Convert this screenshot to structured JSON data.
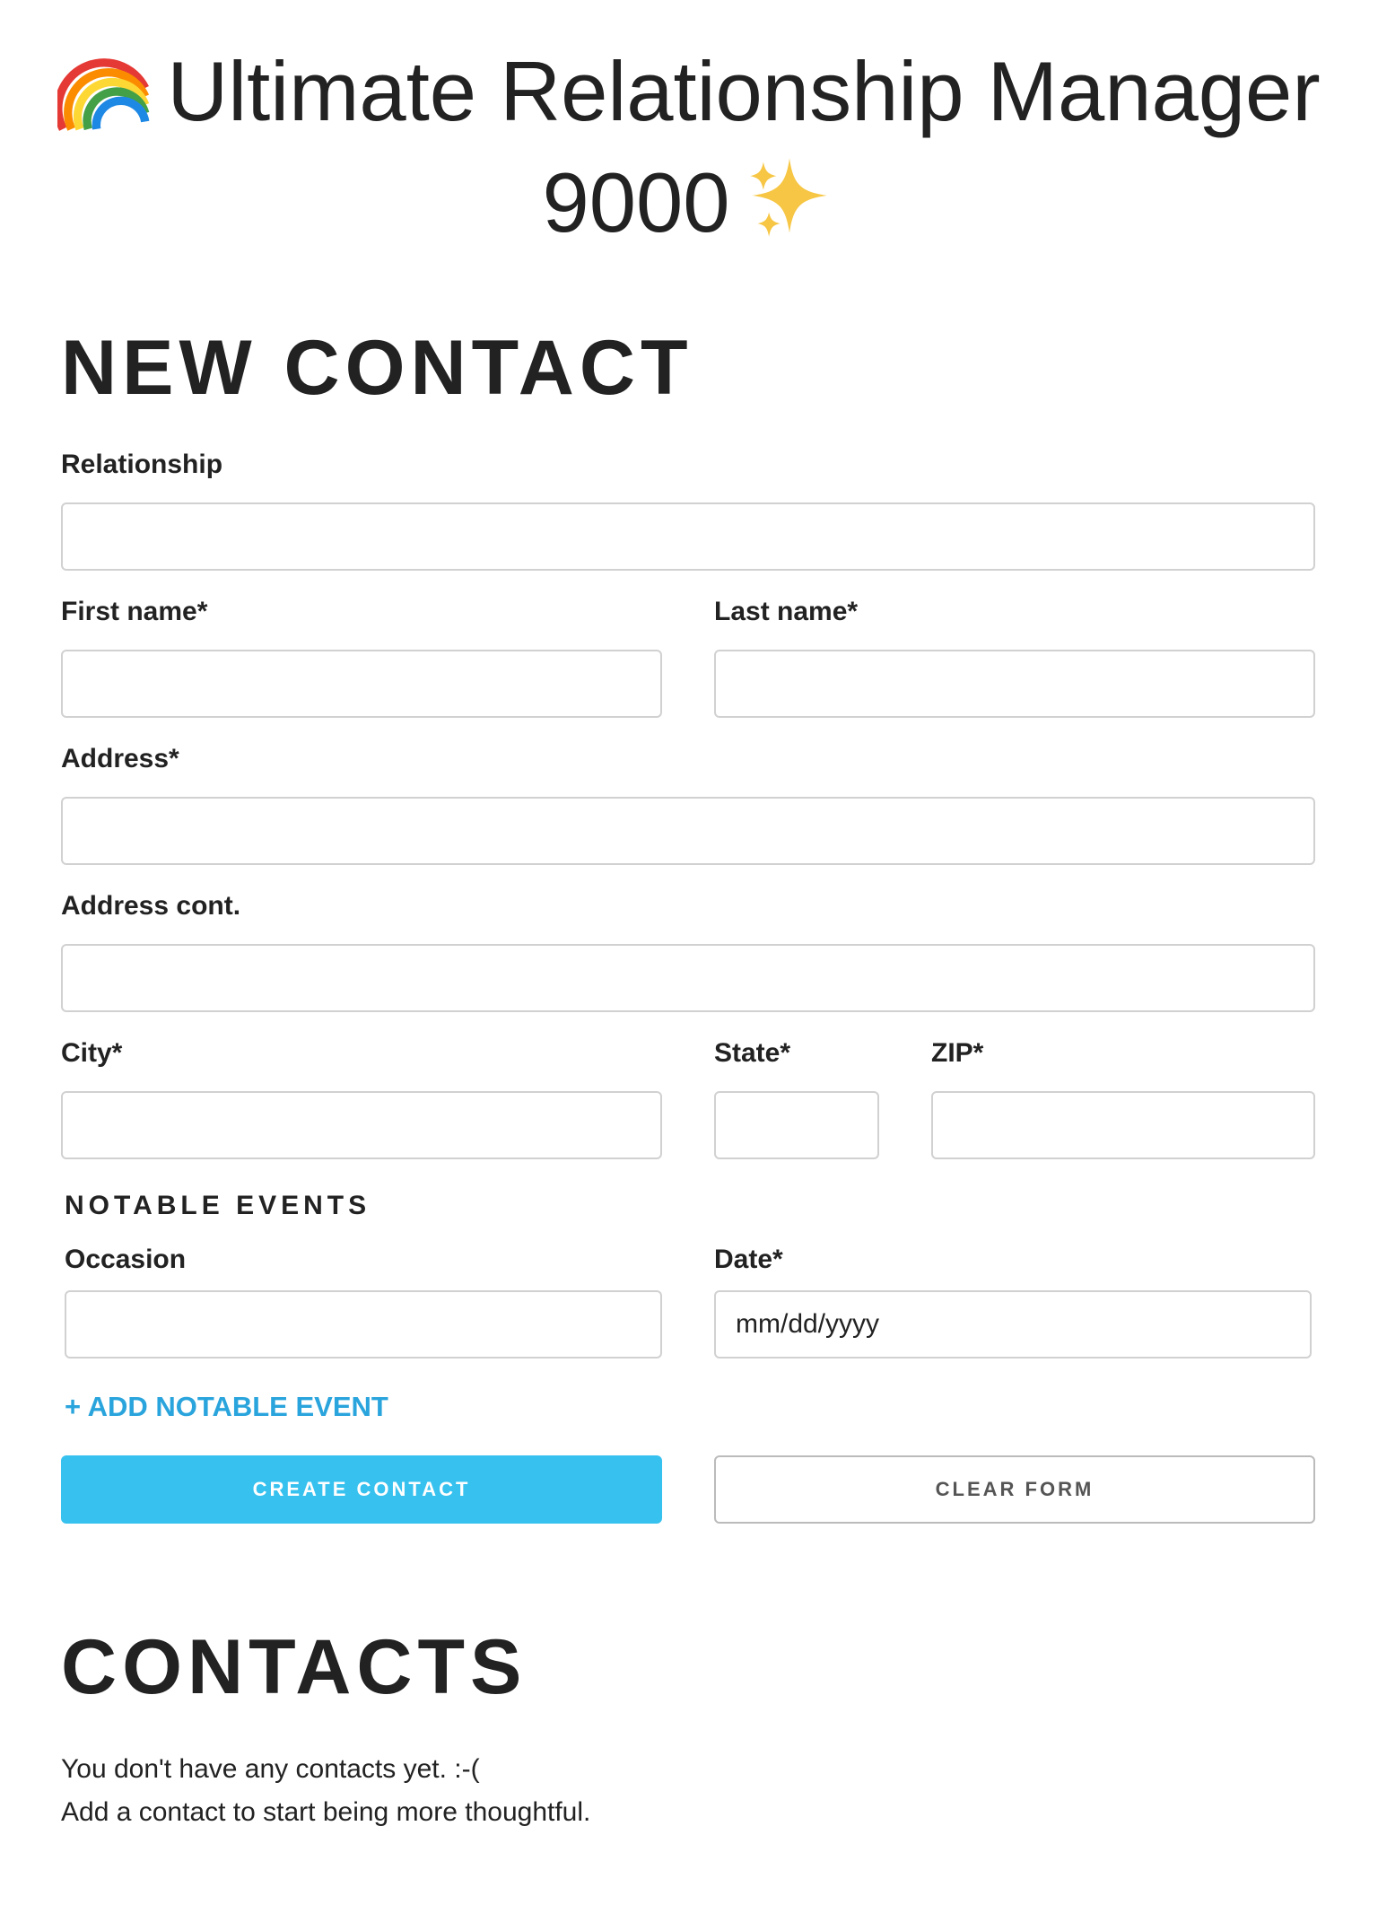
{
  "app": {
    "title": "Ultimate Relationship Manager 9000",
    "title_line1": "Ultimate Relationship Manager",
    "title_line2": "9000"
  },
  "new_contact": {
    "heading": "NEW CONTACT",
    "fields": {
      "relationship": {
        "label": "Relationship",
        "value": "",
        "placeholder": ""
      },
      "first_name": {
        "label": "First name*",
        "value": "",
        "placeholder": ""
      },
      "last_name": {
        "label": "Last name*",
        "value": "",
        "placeholder": ""
      },
      "address": {
        "label": "Address*",
        "value": "",
        "placeholder": ""
      },
      "address_cont": {
        "label": "Address cont.",
        "value": "",
        "placeholder": ""
      },
      "city": {
        "label": "City*",
        "value": "",
        "placeholder": ""
      },
      "state": {
        "label": "State*",
        "value": "",
        "placeholder": ""
      },
      "zip": {
        "label": "ZIP*",
        "value": "",
        "placeholder": ""
      }
    },
    "notable_events": {
      "heading": "NOTABLE EVENTS",
      "occasion": {
        "label": "Occasion",
        "value": "",
        "placeholder": ""
      },
      "date": {
        "label": "Date*",
        "value": "",
        "placeholder": "mm/dd/yyyy"
      },
      "add_link": "+ ADD NOTABLE EVENT"
    },
    "buttons": {
      "create": "CREATE CONTACT",
      "clear": "CLEAR FORM"
    }
  },
  "contacts": {
    "heading": "CONTACTS",
    "empty_line1": "You don't have any contacts yet. :-(",
    "empty_line2": "Add a contact to start being more thoughtful."
  },
  "colors": {
    "accent": "#36c1ef",
    "link": "#2aa4dc",
    "text": "#222222",
    "border": "#d1d1d1"
  },
  "icons": [
    "rainbow-icon",
    "sparkles-icon"
  ]
}
